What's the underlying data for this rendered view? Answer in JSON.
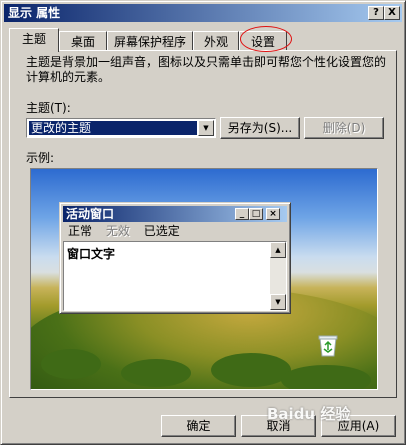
{
  "window": {
    "title": "显示 属性",
    "help_button": "?",
    "close_button": "X"
  },
  "tabs": [
    {
      "label": "主题",
      "active": true
    },
    {
      "label": "桌面",
      "active": false
    },
    {
      "label": "屏幕保护程序",
      "active": false
    },
    {
      "label": "外观",
      "active": false
    },
    {
      "label": "设置",
      "active": false
    }
  ],
  "theme_panel": {
    "description": "主题是背景加一组声音，图标以及只需单击即可帮您个性化设置您的计算机的元素。",
    "theme_label": "主题(T):",
    "theme_selected": "更改的主题",
    "save_as_label": "另存为(S)...",
    "delete_label": "删除(D)",
    "preview_label": "示例:"
  },
  "preview_window": {
    "title": "活动窗口",
    "menu": [
      {
        "label": "正常",
        "disabled": false
      },
      {
        "label": "无效",
        "disabled": true
      },
      {
        "label": "已选定",
        "disabled": false
      }
    ],
    "content_text": "窗口文字"
  },
  "footer": {
    "ok_label": "确定",
    "cancel_label": "取消",
    "apply_label": "应用(A)"
  },
  "watermark": {
    "text": "Baidu 经验"
  },
  "colors": {
    "title_bar": "#0a246a",
    "dialog_face": "#d4d0c8",
    "highlight_ring": "#e01010"
  }
}
